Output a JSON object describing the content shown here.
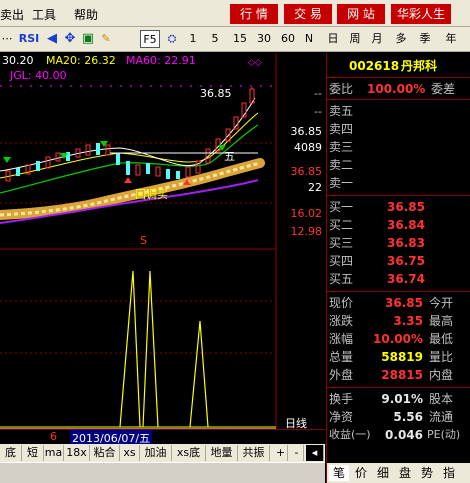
{
  "menu": {
    "items": [
      "卖出",
      "工具",
      "帮助"
    ],
    "buttons": [
      "行 情",
      "交 易",
      "网 站",
      "华彩人生"
    ]
  },
  "toolbar": {
    "rsi_label": "RSI",
    "f5_label": "F5",
    "periods": [
      "1",
      "5",
      "15",
      "30",
      "60",
      "N"
    ],
    "ranges": [
      "日",
      "周",
      "月",
      "多",
      "季",
      "年"
    ]
  },
  "indicators": {
    "ma10": "30.20",
    "ma20": "MA20: 26.32",
    "ma60": "MA60: 22.91",
    "jgl": "JGL: 40.00",
    "colors": {
      "ma10": "#ffffff",
      "ma20": "#ffff00",
      "ma60": "#ff00ff",
      "jgl": "#ff00ff"
    }
  },
  "chart_annotations": {
    "high_price": "36.85",
    "buy_label": "回调买",
    "marker_s": "S",
    "ziliang_label": "五"
  },
  "axis": {
    "price_labels": [
      "--",
      "--",
      "36.85",
      "4089",
      "36.85",
      "22",
      "16.02",
      "12.98"
    ],
    "bottom_label": "日线"
  },
  "date_band": {
    "left_mark": "6",
    "date": "2013/06/07/五"
  },
  "bottom_tabs": [
    "底部",
    "短",
    "ma",
    "18x",
    "粘合",
    "xs",
    "加油",
    "xs底",
    "地量",
    "共振",
    "+",
    "-"
  ],
  "stock": {
    "code": "002618",
    "name": "丹邦科"
  },
  "order_book": {
    "weibi_label": "委比",
    "weibi_value": "100.00%",
    "weicha_label": "委差",
    "asks": [
      {
        "label": "卖五",
        "price": "",
        "vol": ""
      },
      {
        "label": "卖四",
        "price": "",
        "vol": ""
      },
      {
        "label": "卖三",
        "price": "",
        "vol": ""
      },
      {
        "label": "卖二",
        "price": "",
        "vol": ""
      },
      {
        "label": "卖一",
        "price": "",
        "vol": ""
      }
    ],
    "bids": [
      {
        "label": "买一",
        "price": "36.85"
      },
      {
        "label": "买二",
        "price": "36.84"
      },
      {
        "label": "买三",
        "price": "36.83"
      },
      {
        "label": "买四",
        "price": "36.75"
      },
      {
        "label": "买五",
        "price": "36.74"
      }
    ]
  },
  "quote": [
    {
      "l": "现价",
      "v": "36.85",
      "r": "今开",
      "vc": "red"
    },
    {
      "l": "涨跌",
      "v": "3.35",
      "r": "最高",
      "vc": "red"
    },
    {
      "l": "涨幅",
      "v": "10.00%",
      "r": "最低",
      "vc": "red"
    },
    {
      "l": "总量",
      "v": "58819",
      "r": "量比",
      "vc": "yel"
    },
    {
      "l": "外盘",
      "v": "28815",
      "r": "内盘",
      "vc": "red"
    },
    {
      "l": "换手",
      "v": "9.01%",
      "r": "股本",
      "vc": "wht"
    },
    {
      "l": "净资",
      "v": "5.56",
      "r": "流通",
      "vc": "wht"
    },
    {
      "l": "收益(一)",
      "v": "0.046",
      "r": "PE(动)",
      "vc": "wht"
    }
  ],
  "right_tabs": [
    "笔",
    "价",
    "细",
    "盘",
    "势",
    "指"
  ]
}
